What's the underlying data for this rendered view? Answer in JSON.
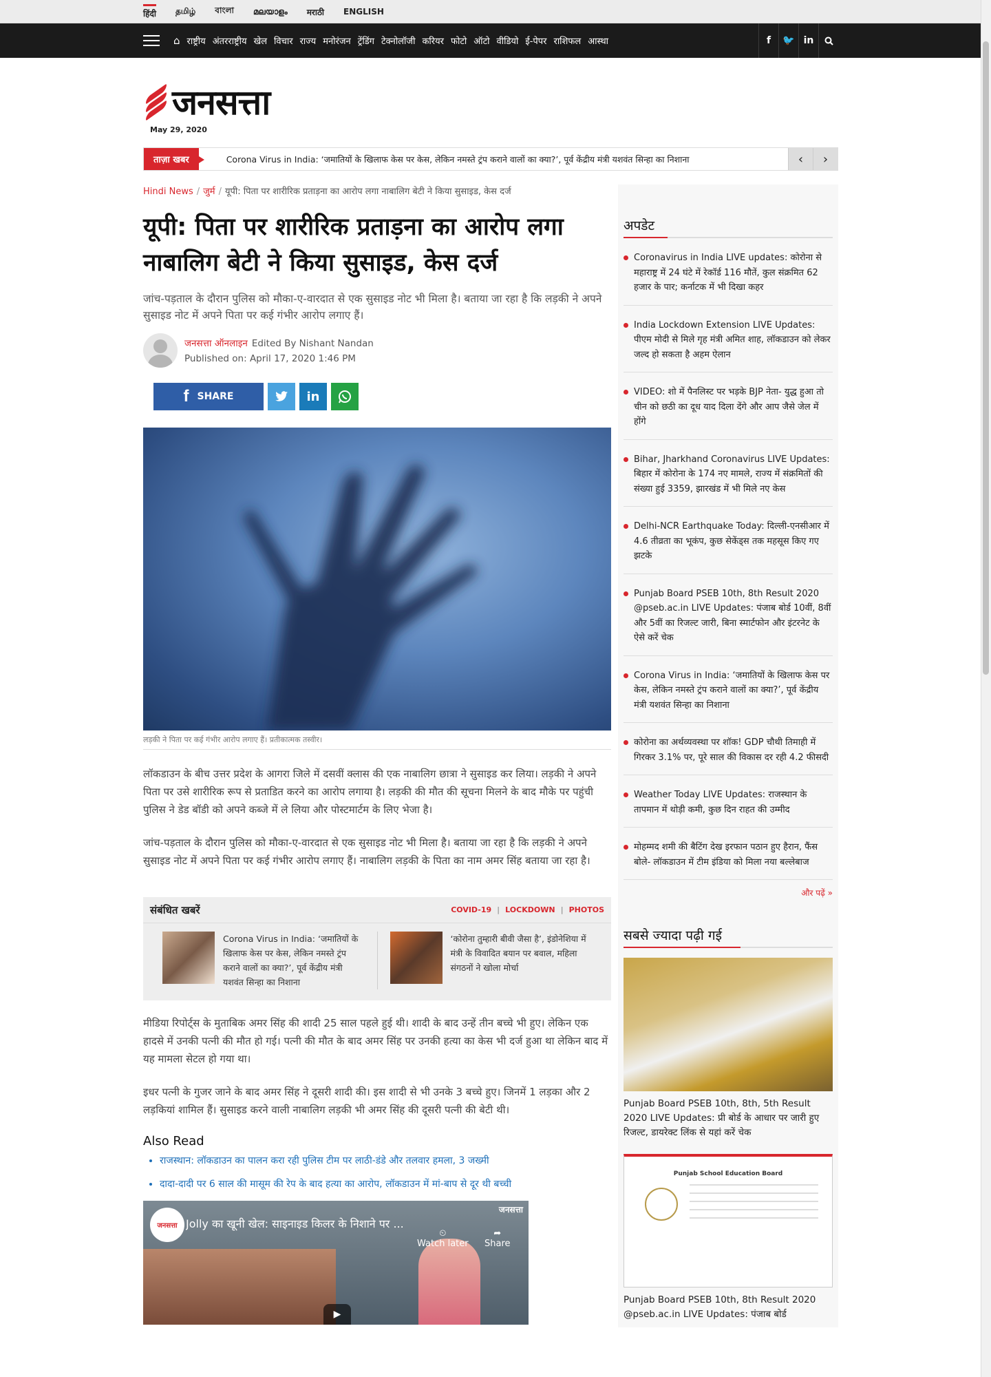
{
  "languages": [
    {
      "label": "हिंदी",
      "active": true
    },
    {
      "label": "தமிழ்"
    },
    {
      "label": "বাংলা"
    },
    {
      "label": "മലയാളം"
    },
    {
      "label": "मराठी"
    },
    {
      "label": "ENGLISH"
    }
  ],
  "nav": {
    "items": [
      "राष्ट्रीय",
      "अंतरराष्ट्रीय",
      "खेल",
      "विचार",
      "राज्य",
      "मनोरंजन",
      "ट्रेंडिंग",
      "टेक्नोलॉजी",
      "करियर",
      "फोटो",
      "ऑटो",
      "वीडियो",
      "ई-पेपर",
      "राशिफल",
      "आस्था"
    ],
    "socials": [
      "f",
      "t",
      "in",
      "search"
    ]
  },
  "logo": {
    "text": "जनसत्ता",
    "date": "May 29, 2020"
  },
  "ticker": {
    "label": "ताज़ा खबर",
    "text": "Corona Virus in India: ‘जमातियों के खिलाफ केस पर केस, लेकिन नमस्ते ट्रंप कराने वालों का क्या?’, पूर्व केंद्रीय मंत्री यशवंत सिन्हा का निशाना",
    "prev": "‹",
    "next": "›"
  },
  "breadcrumb": {
    "home": "Hindi News",
    "category": "जुर्म",
    "current": "यूपी: पिता पर शारीरिक प्रताड़ना का आरोप लगा नाबालिग बेटी ने किया सुसाइड, केस दर्ज"
  },
  "article": {
    "headline": "यूपी: पिता पर शारीरिक प्रताड़ना का आरोप लगा नाबालिग बेटी ने किया सुसाइड, केस दर्ज",
    "summary": "जांच-पड़ताल के दौरान पुलिस को मौका-ए-वारदात से एक सुसाइड नोट भी मिला है। बताया जा रहा है कि लड़की ने अपने सुसाइड नोट में अपने पिता पर कई गंभीर आरोप लगाए हैं।",
    "author": "जनसत्ता ऑनलाइन",
    "editor": "Edited By Nishant Nandan",
    "published": "Published on: April 17, 2020 1:46 PM",
    "share_label": "SHARE",
    "caption": "लड़की ने पिता पर कई गंभीर आरोप लगाए हैं। प्रतीकात्मक तस्वीर।",
    "paragraphs": [
      "लॉकडाउन के बीच उत्तर प्रदेश के आगरा जिले में दसवीं क्लास की एक नाबालिग छात्रा ने सुसाइड कर लिया। लड़की ने अपने पिता पर उसे शारीरिक रूप से प्रताडित करने का आरोप लगाया है। लड़की की मौत की सूचना मिलने के बाद मौके पर पहुंची पुलिस ने डेड बॉडी को अपने कब्जे में ले लिया और पोस्टमार्टम के लिए भेजा है।",
      " जांच-पड़ताल के दौरान पुलिस को मौका-ए-वारदात से एक सुसाइड नोट भी मिला है। बताया जा रहा है कि लड़की ने अपने सुसाइड नोट में अपने पिता पर कई गंभीर आरोप लगाए हैं। नाबालिग लड़की के पिता का नाम अमर सिंह बताया जा रहा है।"
    ],
    "paragraphs_after": [
      "मीडिया रिपोर्ट्स के मुताबिक अमर सिंह की शादी 25 साल पहले हुई थी। शादी के बाद उन्हें तीन बच्चे भी हुए। लेकिन एक हादसे में उनकी पत्नी की मौत हो गई। पत्नी की मौत के बाद अमर सिंह पर उनकी हत्या का केस भी दर्ज हुआ था लेकिन बाद में यह मामला सेटल हो गया था।",
      "इधर पत्नी के गुजर जाने के बाद अमर सिंह ने दूसरी शादी की। इस शादी से भी उनके 3 बच्चे हुए। जिनमें 1 लड़का और 2 लड़कियां शामिल हैं। सुसाइड करने वाली नाबालिग लड़की भी अमर सिंह की दूसरी पत्नी की बेटी थी।"
    ],
    "also_read_title": "Also Read",
    "also_read": [
      "राजस्थान: लॉकडाउन का पालन करा रही पुलिस टीम पर लाठी-डंडे और तलवार हमला, 3 जख्मी",
      "दादा-दादी पर 6 साल की मासूम की रेप के बाद हत्या का आरोप, लॉकडाउन में मां-बाप से दूर थी बच्ची"
    ]
  },
  "related": {
    "title": "संबंधित खबरें",
    "tags": [
      "COVID-19",
      "LOCKDOWN",
      "PHOTOS"
    ],
    "items": [
      "Corona Virus in India: ‘जमातियों के खिलाफ केस पर केस, लेकिन नमस्ते ट्रंप कराने वालों का क्या?’, पूर्व केंद्रीय मंत्री यशवंत सिन्हा का निशाना",
      "‘कोरोना तुम्हारी बीवी जैसा है’, इंडोनेशिया में मंत्री के विवादित बयान पर बवाल, महिला संगठनों ने खोला मोर्चा"
    ]
  },
  "video": {
    "title": "Jolly का खूनी खेल: साइनाइड किलर के निशाने पर ...",
    "watch_later": "Watch later",
    "share": "Share",
    "brand": "जनसत्ता",
    "logo_text": "जनसत्ता"
  },
  "sidebar": {
    "updates_title": "अपडेट",
    "updates": [
      "Coronavirus in India LIVE updates: कोरोना से महाराष्ट्र में 24 घंटे में रेकॉर्ड 116 मौतें, कुल संक्रमित 62 हजार के पार; कर्नाटक में भी दिखा कहर",
      "India Lockdown Extension LIVE Updates: पीएम मोदी से मिले गृह मंत्री अमित शाह, लॉकडाउन को लेकर जल्द हो सकता है अहम ऐलान",
      "VIDEO: शो में पैनलिस्ट पर भड़के BJP नेता- युद्ध हुआ तो चीन को छठी का दूध याद दिला देंगे और आप जैसे जेल में होंगे",
      "Bihar, Jharkhand Coronavirus LIVE Updates: बिहार में कोरोना के 174 नए मामले, राज्य में संक्रमितों की संख्या हुई 3359, झारखंड में भी मिले नए केस",
      "Delhi-NCR Earthquake Today: दिल्ली-एनसीआर में 4.6 तीव्रता का भूकंप, कुछ सेकेंड्स तक महसूस किए गए झटके",
      "Punjab Board PSEB 10th, 8th Result 2020 @pseb.ac.in LIVE Updates: पंजाब बोर्ड 10वीं, 8वीं और 5वीं का रिजल्ट जारी, बिना स्मार्टफोन और इंटरनेट के ऐसे करें चेक",
      "Corona Virus in India: ‘जमातियों के खिलाफ केस पर केस, लेकिन नमस्ते ट्रंप कराने वालों का क्या?’, पूर्व केंद्रीय मंत्री यशवंत सिन्हा का निशाना",
      "कोरोना का अर्थव्यवस्था पर शॉक! GDP चौथी तिमाही में गिरकर 3.1% पर, पूरे साल की विकास दर रही 4.2 फीसदी",
      "Weather Today LIVE Updates: राजस्थान के तापमान में थोड़ी कमी, कुछ दिन राहत की उम्मीद",
      "मोहम्मद शमी की बैटिंग देख इरफान पठान हुए हैरान, फैंस बोले- लॉकडाउन में टीम इंडिया को मिला नया बल्लेबाज"
    ],
    "more": "और पढ़ें »",
    "most_read_title": "सबसे ज्यादा पढ़ी गई",
    "most_read": [
      "Punjab Board PSEB 10th, 8th, 5th Result 2020 LIVE Updates: प्री बोर्ड के आधार पर जारी हुए रिजल्ट, डायरेक्ट लिंक से यहां करें चेक",
      "Punjab Board PSEB 10th, 8th Result 2020 @pseb.ac.in LIVE Updates: पंजाब बोर्ड"
    ],
    "board_image_title": "Punjab School Education Board"
  },
  "colors": {
    "brand_red": "#d8262d",
    "nav_bg": "#1b1b1b",
    "link_blue": "#1d6fb8",
    "facebook": "#2f5ea7",
    "twitter": "#4aa3df",
    "linkedin": "#1a7bb9",
    "whatsapp": "#25a244"
  }
}
